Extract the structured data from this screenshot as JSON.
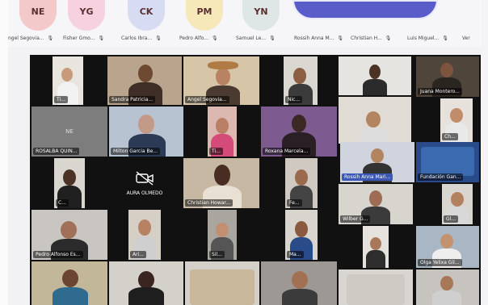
{
  "top_strip": {
    "avatars": [
      {
        "initials": "NE",
        "color": "#f4c9c9"
      },
      {
        "initials": "YG",
        "color": "#f6d1e0"
      },
      {
        "initials": "CK",
        "color": "#d8dcf2"
      },
      {
        "initials": "PM",
        "color": "#f6e8b8"
      },
      {
        "initials": "YN",
        "color": "#dfe7e6"
      },
      {
        "initials": "",
        "color": "#5a5cc9"
      }
    ],
    "names": [
      "ngel Segovia...",
      "Fisher Gmo...",
      "Carlos Ibra...",
      "Pedro Alfo...",
      "Samuel Le...",
      "Rossih Anna M...",
      "Christian H...",
      "Luis Miguel...",
      "Ver"
    ]
  },
  "tiles": [
    {
      "label": "Ti...",
      "bg": "#e8e4de"
    },
    {
      "label": "Sandra Patricia...",
      "bg": "#b9a58e"
    },
    {
      "label": "Angel Segovia...",
      "bg": "#d6c5a6"
    },
    {
      "label": "Nic...",
      "bg": "#d9d7d0"
    },
    {
      "label": "",
      "bg": "#e6e4e0"
    },
    {
      "label": "Juana Montero...",
      "bg": "#50453b"
    },
    {
      "label": "NE",
      "bg": "#7d7d7d"
    },
    {
      "label": "Milton Garcia Be...",
      "bg": "#b7c3d1"
    },
    {
      "label": "Ti...",
      "bg": "#dcb9b0"
    },
    {
      "label": "Roxana Marcela...",
      "bg": "#7d5a8f"
    },
    {
      "label": "",
      "bg": "#e0dcd5"
    },
    {
      "label": "Ch...",
      "bg": "#e6e2db"
    },
    {
      "label": "ROSALBA QUIN...",
      "bg": "#7a7a7a"
    },
    {
      "label": "C...",
      "bg": "#d9d6d0"
    },
    {
      "label": "AURA OLMEDO",
      "bg": "#111"
    },
    {
      "label": "Christian Howar...",
      "bg": "#c6b8a3"
    },
    {
      "label": "Fe...",
      "bg": "#cfc9c1"
    },
    {
      "label": "Rossih Anna Mari...",
      "bg": "#cfd4df"
    },
    {
      "label": "Fundación Gan...",
      "bg": "#2a4b8a"
    },
    {
      "label": "Pedro Alfonso Es...",
      "bg": "#c9c5c1"
    },
    {
      "label": "Ari...",
      "bg": "#d6cfc6"
    },
    {
      "label": "Sil...",
      "bg": "#a9a6a0"
    },
    {
      "label": "Ma...",
      "bg": "#d8d4ce"
    },
    {
      "label": "Wilber G...",
      "bg": "#d8d4ce"
    },
    {
      "label": "Gl...",
      "bg": "#d9d5cf"
    },
    {
      "label": "",
      "bg": "#e6e3df"
    },
    {
      "label": "Olga Yelixa Gil...",
      "bg": "#a8b7c3"
    },
    {
      "label": "",
      "bg": "#c2b799"
    },
    {
      "label": "",
      "bg": "#d4d0ca"
    },
    {
      "label": "",
      "bg": "#d5cfc9"
    },
    {
      "label": "",
      "bg": "#9d9894"
    },
    {
      "label": "",
      "bg": "#d9d6d2"
    },
    {
      "label": "",
      "bg": "#c7c3be"
    }
  ]
}
